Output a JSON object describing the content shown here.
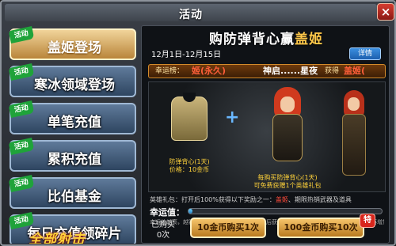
{
  "window": {
    "title": "活动",
    "close_label": "×"
  },
  "sidebar": {
    "items": [
      {
        "label": "盖姬登场",
        "tag": "活动",
        "active": true
      },
      {
        "label": "寒冰领域登场",
        "tag": "活动",
        "active": false
      },
      {
        "label": "单笔充值",
        "tag": "活动",
        "active": false
      },
      {
        "label": "累积充值",
        "tag": "活动",
        "active": false
      },
      {
        "label": "比伯基金",
        "tag": "活动",
        "active": false
      },
      {
        "label": "每日充值领碎片",
        "tag": "活动",
        "active": false
      }
    ],
    "logo_text": "全部射击"
  },
  "event": {
    "title_part1": "购防弹背心赢",
    "title_highlight": "盖姬",
    "date_range": "12月1日-12月15日",
    "details_label": "详情",
    "rank_label": "幸运榜：",
    "rank_name1": "姬(永久)",
    "rank_name2": "神启......星夜",
    "rank_gain": "获得",
    "rank_name3": "盖姬(",
    "plus": "+",
    "item1_name": "防弹背心(1天)",
    "item1_price": "价格：10金币",
    "item2_desc_line1": "每购买防弹背心(1天)",
    "item2_desc_line2": "可免费获赠1个英雄礼包",
    "note_prefix": "英雄礼包：打开后100%获得以下奖励之一：",
    "note_red": "盖姬",
    "note_suffix": "、期限热销武器及道具",
    "luck_label": "幸运值：",
    "luck_value": 0.02,
    "tiny_note": "幸运值越高，越容易获得盖姬，幸运值达到上限后获得盖姬。活动结束后幸运值将清空且不再增加",
    "bought_line1": "已购买",
    "bought_line2": "0次",
    "buy1_label": "10金币购买1次",
    "buy10_label": "100金币购买10次",
    "discount_badge": "特"
  }
}
